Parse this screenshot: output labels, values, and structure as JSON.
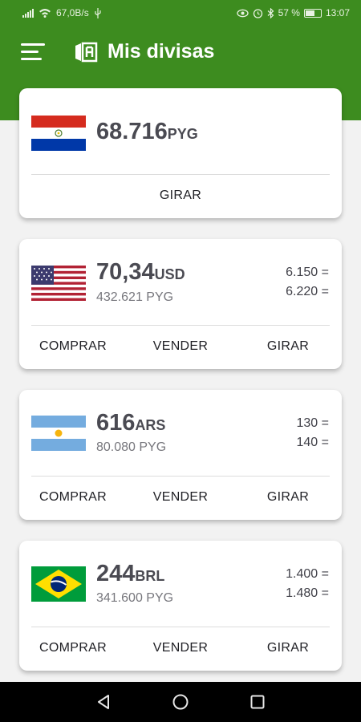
{
  "status_bar": {
    "net_speed": "67,0B/s",
    "battery": "57 %",
    "time": "13:07",
    "icons": [
      "signal-icon",
      "wifi-icon",
      "usb-icon",
      "eye-icon",
      "alarm-icon",
      "bluetooth-icon",
      "battery-icon"
    ]
  },
  "app": {
    "title": "Mis divisas",
    "brand_color": "#3d8c1f",
    "menu_icon": "hamburger-menu-icon",
    "logo_icon": "exchange-logo-icon"
  },
  "cards": [
    {
      "currency": "PYG",
      "flag": "paraguay-flag",
      "amount": "68.716",
      "code": "PYG",
      "actions": [
        "GIRAR"
      ]
    },
    {
      "currency": "USD",
      "flag": "usa-flag",
      "amount": "70,34",
      "code": "USD",
      "converted": "432.621 PYG",
      "buy_rate": "6.150",
      "sell_rate": "6.220",
      "actions": [
        "COMPRAR",
        "VENDER",
        "GIRAR"
      ]
    },
    {
      "currency": "ARS",
      "flag": "argentina-flag",
      "amount": "616",
      "code": "ARS",
      "converted": "80.080 PYG",
      "buy_rate": "130",
      "sell_rate": "140",
      "actions": [
        "COMPRAR",
        "VENDER",
        "GIRAR"
      ]
    },
    {
      "currency": "BRL",
      "flag": "brazil-flag",
      "amount": "244",
      "code": "BRL",
      "converted": "341.600 PYG",
      "buy_rate": "1.400",
      "sell_rate": "1.480",
      "actions": [
        "COMPRAR",
        "VENDER",
        "GIRAR"
      ]
    }
  ],
  "nav": {
    "icons": [
      "back-triangle-icon",
      "home-circle-icon",
      "recents-square-icon"
    ]
  }
}
